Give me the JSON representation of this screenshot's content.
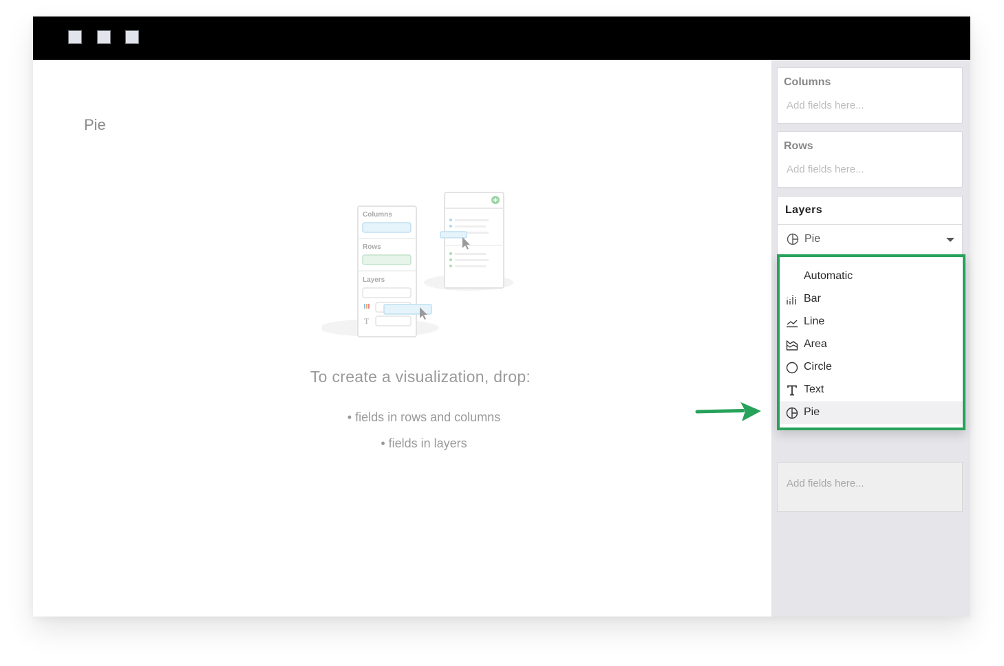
{
  "window": {
    "controls": [
      "window-control-1",
      "window-control-2",
      "window-control-3"
    ]
  },
  "main": {
    "title": "Pie",
    "illustration": {
      "columns_label": "Columns",
      "rows_label": "Rows",
      "layers_label": "Layers",
      "text_glyph": "T"
    },
    "empty_state": {
      "heading": "To create a visualization, drop:",
      "items": [
        "• fields in rows and columns",
        "• fields in layers"
      ]
    }
  },
  "sidebar": {
    "columns": {
      "title": "Columns",
      "placeholder": "Add fields here..."
    },
    "rows": {
      "title": "Rows",
      "placeholder": "Add fields here..."
    },
    "layers": {
      "title": "Layers",
      "selected": "Pie",
      "selected_icon": "pie-icon",
      "below_placeholder": "Add fields here..."
    }
  },
  "dropdown": {
    "border_color": "#27a25a",
    "items": [
      {
        "label": "Automatic",
        "icon": ""
      },
      {
        "label": "Bar",
        "icon": "bar-chart-icon"
      },
      {
        "label": "Line",
        "icon": "line-chart-icon"
      },
      {
        "label": "Area",
        "icon": "area-chart-icon"
      },
      {
        "label": "Circle",
        "icon": "circle-icon"
      },
      {
        "label": "Text",
        "icon": "text-icon"
      },
      {
        "label": "Pie",
        "icon": "pie-icon",
        "selected": true
      }
    ]
  },
  "annotation": {
    "arrow_color": "#27a25a"
  }
}
